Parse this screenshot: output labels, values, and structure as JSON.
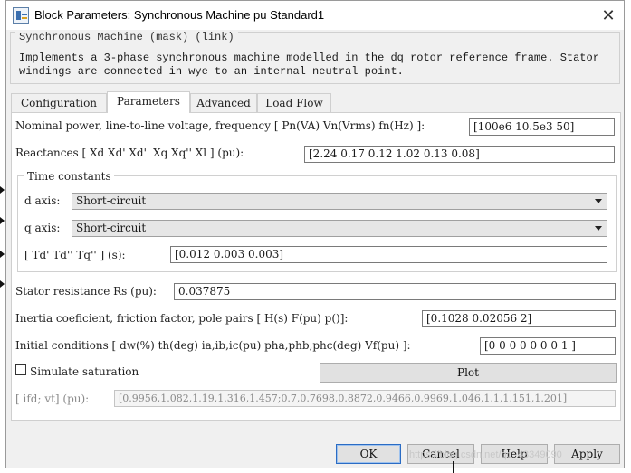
{
  "window": {
    "title": "Block Parameters: Synchronous Machine pu Standard1",
    "close_glyph": "✕"
  },
  "mask": {
    "title": "Synchronous Machine (mask) (link)",
    "description": "Implements a 3-phase synchronous machine modelled in the dq rotor reference frame. Stator windings are connected in wye to an internal neutral point."
  },
  "tabs": [
    {
      "label": "Configuration",
      "active": false
    },
    {
      "label": "Parameters",
      "active": true
    },
    {
      "label": "Advanced",
      "active": false
    },
    {
      "label": "Load Flow",
      "active": false
    }
  ],
  "params": {
    "nominal_label": "Nominal power, line-to-line voltage, frequency [ Pn(VA)  Vn(Vrms)  fn(Hz) ]:",
    "nominal_value": "[100e6 10.5e3 50]",
    "reactances_label": "Reactances [ Xd  Xd'  Xd''  Xq  Xq''  Xl ] (pu):",
    "reactances_value": "[2.24 0.17 0.12 1.02 0.13 0.08]",
    "time_constants": {
      "title": "Time constants",
      "d_axis_label": "d axis:",
      "d_axis_value": "Short-circuit",
      "q_axis_label": "q axis:",
      "q_axis_value": "Short-circuit",
      "t_label": "[ Td'  Td''  Tq'' ] (s):",
      "t_value": "[0.012 0.003 0.003]"
    },
    "stator_label": "Stator resistance Rs (pu):",
    "stator_value": "0.037875",
    "inertia_label": "Inertia coeficient, friction factor, pole pairs [ H(s)  F(pu)  p()]:",
    "inertia_value": "[0.1028 0.02056 2]",
    "initial_label": "Initial conditions [ dw(%)  th(deg)  ia,ib,ic(pu)  pha,phb,phc(deg)  Vf(pu) ]:",
    "initial_value": "[0  0  0  0  0  0  0  1 ]",
    "saturation_label": "Simulate saturation",
    "saturation_checked": false,
    "plot_label": "Plot",
    "ifd_label": "[ ifd; vt] (pu):",
    "ifd_value": "[0.9956,1.082,1.19,1.316,1.457;0.7,0.7698,0.8872,0.9466,0.9969,1.046,1.1,1.151,1.201]"
  },
  "buttons": {
    "ok": "OK",
    "cancel": "Cancel",
    "help": "Help",
    "apply": "Apply"
  },
  "watermark": "https://blog.csdn.net/qq_43349090"
}
